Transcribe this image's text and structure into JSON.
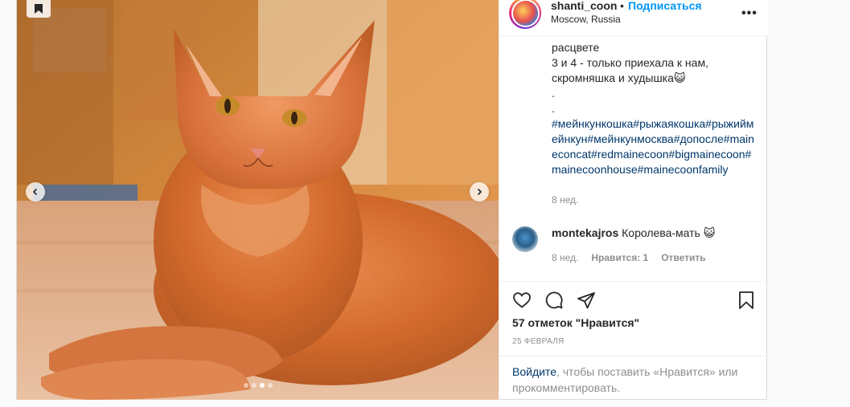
{
  "post": {
    "username": "shanti_coon",
    "bullet": "•",
    "follow_label": "Подписаться",
    "location": "Moscow, Russia",
    "more_label": "•••"
  },
  "caption": {
    "lines": [
      "расцвете",
      "3 и 4 - только приехала к нам,",
      "скромняшка и худышка😺",
      ".",
      "."
    ],
    "hashtags": "#мейнкункошка#рыжаякошка#рыжиймейнкун#мейнкунмосква#допосле#maineconcat#redmainecoon#bigmainecoon#mainecoonhouse#mainecoonfamily",
    "time": "8 нед."
  },
  "comment": {
    "username": "montekajros",
    "text": "Королева-мать 😺",
    "time": "8 нед.",
    "likes": "Нравится: 1",
    "reply_label": "Ответить"
  },
  "engagement": {
    "likes_text": "57 отметок \"Нравится\"",
    "date": "25 ФЕВРАЛЯ"
  },
  "login_prompt": {
    "link": "Войдите",
    "text": ", чтобы поставить «Нравится» или прокомментировать."
  },
  "carousel": {
    "slide_count": 4,
    "active_slide": 3
  },
  "icons": {
    "top_left": "bookmark-badge-icon",
    "prev": "chevron-left-icon",
    "next": "chevron-right-icon",
    "like": "heart-icon",
    "comment": "comment-icon",
    "share": "share-icon",
    "save": "bookmark-icon",
    "more": "more-icon"
  },
  "colors": {
    "link": "#00376b",
    "follow": "#0095f6",
    "muted": "#8e8e8e",
    "text": "#262626"
  }
}
